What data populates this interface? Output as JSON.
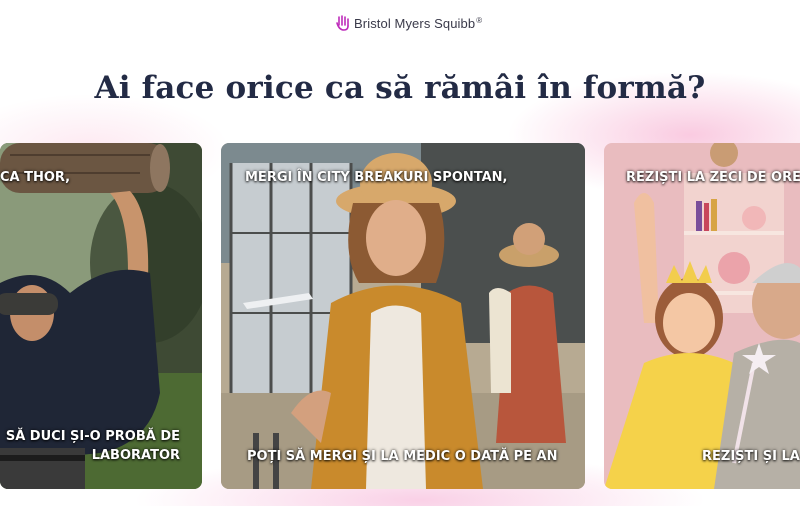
{
  "brand": {
    "name": "Bristol Myers Squibb",
    "mark": "®"
  },
  "headline": "Ai face orice ca să rămâi în formă?",
  "cards": [
    {
      "top_caption": "CA THOR,",
      "bottom_caption_line1": "SĂ DUCI ȘI-O PROBĂ DE",
      "bottom_caption_line2": "LABORATOR"
    },
    {
      "top_caption": "MERGI ÎN CITY BREAKURI SPONTAN,",
      "bottom_caption_line1": "POȚI SĂ MERGI ȘI LA MEDIC O DATĂ PE AN"
    },
    {
      "top_caption": "REZIȘTI LA ZECI DE ORE",
      "bottom_caption_line1": "REZIȘTI ȘI LA T"
    }
  ],
  "colors": {
    "headline": "#232b45",
    "brand_accent": "#be2bbb",
    "glow": "#f5a0c8"
  },
  "icons": [
    "bms-logo-icon"
  ]
}
